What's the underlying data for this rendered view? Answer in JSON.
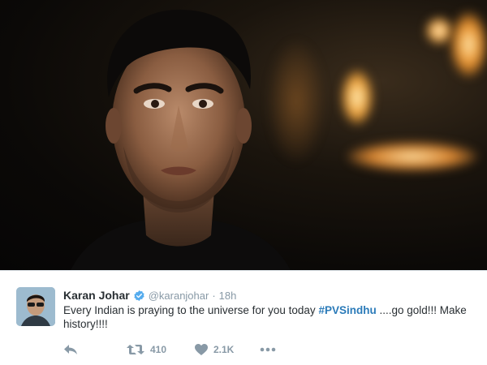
{
  "tweet": {
    "author_name": "Karan Johar",
    "verified": true,
    "handle": "@karanjohar",
    "separator": "·",
    "time": "18h",
    "text_before": "Every Indian is praying to the universe for you today ",
    "hashtag": "#PVSindhu",
    "text_after": " ....go gold!!! Make history!!!!",
    "colors": {
      "hashtag": "#2b7bb9",
      "verified": "#55acee",
      "meta": "#8899a6",
      "text": "#292f33"
    }
  },
  "actions": {
    "reply_icon": "reply-icon",
    "retweet_icon": "retweet-icon",
    "retweet_count": "410",
    "like_icon": "heart-icon",
    "like_count": "2.1K",
    "more_icon": "more-dots-icon"
  }
}
